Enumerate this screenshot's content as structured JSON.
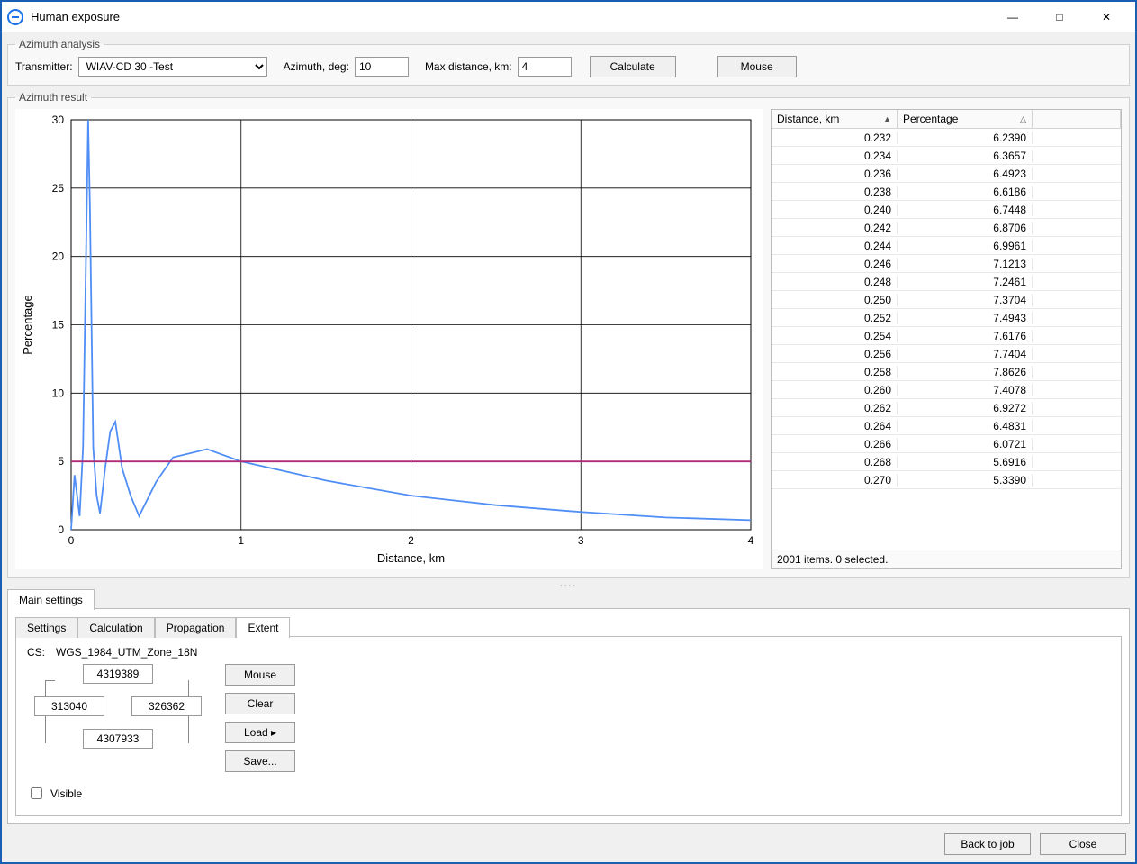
{
  "window": {
    "title": "Human exposure"
  },
  "azimuth_analysis": {
    "legend": "Azimuth analysis",
    "transmitter_label": "Transmitter:",
    "transmitter_value": "WIAV-CD 30 -Test",
    "azimuth_label": "Azimuth, deg:",
    "azimuth_value": "10",
    "maxdist_label": "Max distance, km:",
    "maxdist_value": "4",
    "calculate_label": "Calculate",
    "mouse_label": "Mouse"
  },
  "azimuth_result": {
    "legend": "Azimuth result",
    "grid": {
      "col_distance": "Distance, km",
      "col_percentage": "Percentage",
      "rows": [
        {
          "d": "0.232",
          "p": "6.2390"
        },
        {
          "d": "0.234",
          "p": "6.3657"
        },
        {
          "d": "0.236",
          "p": "6.4923"
        },
        {
          "d": "0.238",
          "p": "6.6186"
        },
        {
          "d": "0.240",
          "p": "6.7448"
        },
        {
          "d": "0.242",
          "p": "6.8706"
        },
        {
          "d": "0.244",
          "p": "6.9961"
        },
        {
          "d": "0.246",
          "p": "7.1213"
        },
        {
          "d": "0.248",
          "p": "7.2461"
        },
        {
          "d": "0.250",
          "p": "7.3704"
        },
        {
          "d": "0.252",
          "p": "7.4943"
        },
        {
          "d": "0.254",
          "p": "7.6176"
        },
        {
          "d": "0.256",
          "p": "7.7404"
        },
        {
          "d": "0.258",
          "p": "7.8626"
        },
        {
          "d": "0.260",
          "p": "7.4078"
        },
        {
          "d": "0.262",
          "p": "6.9272"
        },
        {
          "d": "0.264",
          "p": "6.4831"
        },
        {
          "d": "0.266",
          "p": "6.0721"
        },
        {
          "d": "0.268",
          "p": "5.6916"
        },
        {
          "d": "0.270",
          "p": "5.3390"
        }
      ],
      "status": "2001 items. 0 selected."
    }
  },
  "chart_data": {
    "type": "line",
    "title": "",
    "xlabel": "Distance, km",
    "ylabel": "Percentage",
    "xlim": [
      0,
      4
    ],
    "ylim": [
      0,
      30
    ],
    "xticks": [
      0,
      1,
      2,
      3,
      4
    ],
    "yticks": [
      0,
      5,
      10,
      15,
      20,
      25,
      30
    ],
    "series": [
      {
        "name": "Percentage",
        "color": "#4f8ef5",
        "x": [
          0.0,
          0.02,
          0.04,
          0.05,
          0.07,
          0.09,
          0.1,
          0.11,
          0.13,
          0.15,
          0.17,
          0.2,
          0.23,
          0.26,
          0.3,
          0.35,
          0.4,
          0.5,
          0.6,
          0.8,
          1.0,
          1.5,
          2.0,
          2.5,
          3.0,
          3.5,
          4.0
        ],
        "y": [
          0.0,
          4.0,
          2.0,
          1.0,
          6.0,
          22.0,
          30.0,
          24.0,
          6.0,
          2.5,
          1.2,
          4.5,
          7.2,
          7.9,
          4.5,
          2.5,
          1.0,
          3.5,
          5.3,
          5.9,
          5.0,
          3.6,
          2.5,
          1.8,
          1.3,
          0.9,
          0.7
        ]
      },
      {
        "name": "Threshold",
        "color": "#b02a7a",
        "x": [
          0,
          4
        ],
        "y": [
          5,
          5
        ]
      }
    ]
  },
  "settings": {
    "main_tab": "Main settings",
    "inner_tabs": {
      "settings": "Settings",
      "calculation": "Calculation",
      "propagation": "Propagation",
      "extent": "Extent"
    },
    "extent": {
      "cs_label": "CS:",
      "cs_value": "WGS_1984_UTM_Zone_18N",
      "north": "4319389",
      "south": "4307933",
      "west": "313040",
      "east": "326362",
      "mouse": "Mouse",
      "clear": "Clear",
      "load": "Load ▸",
      "save": "Save...",
      "visible": "Visible"
    }
  },
  "footer": {
    "back": "Back to job",
    "close": "Close"
  }
}
